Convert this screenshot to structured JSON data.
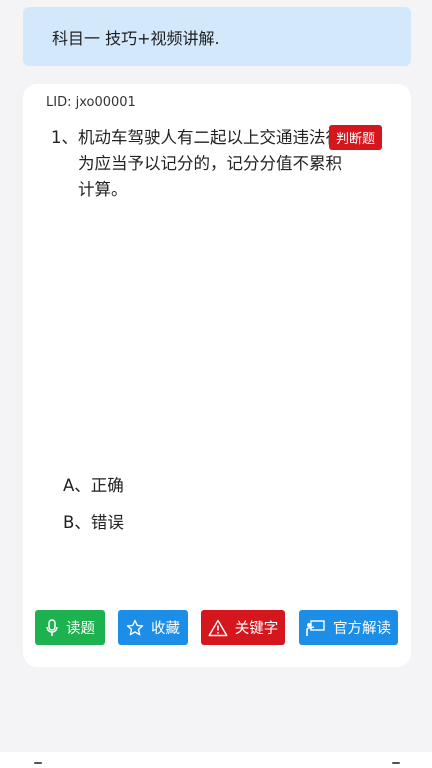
{
  "banner": {
    "text": "科目一 技巧+视频讲解."
  },
  "card": {
    "lid": "LID: jxo00001",
    "question": {
      "number": "1、",
      "text": "机动车驾驶人有二起以上交通违法行为应当予以记分的，记分分值不累积计算。",
      "type_badge": "判断题"
    },
    "options": [
      {
        "label": "A、正确"
      },
      {
        "label": "B、错误"
      }
    ],
    "actions": {
      "read_label": "读题",
      "favorite_label": "收藏",
      "keyword_label": "关键字",
      "explain_label": "官方解读"
    }
  },
  "colors": {
    "banner_bg": "#d3e8fb",
    "badge_red": "#d5161d",
    "green": "#1db24f",
    "blue": "#1d8ee8"
  },
  "icons": {
    "read": "microphone-icon",
    "favorite": "star-icon",
    "keyword": "warning-triangle-icon",
    "explain": "presentation-icon"
  }
}
